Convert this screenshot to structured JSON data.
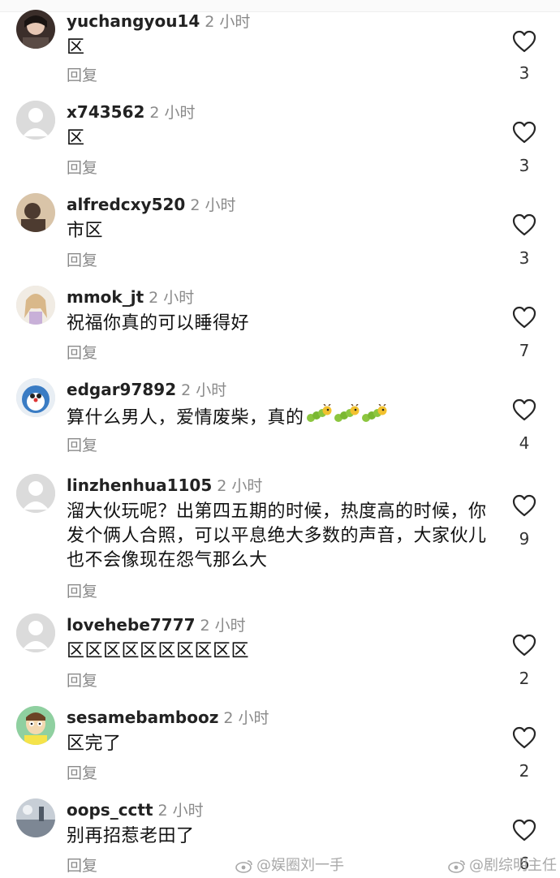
{
  "comments": [
    {
      "username": "yuchangyou14",
      "time": "2 小时",
      "text": "区",
      "reply": "回复",
      "likes": "3"
    },
    {
      "username": "x743562",
      "time": "2 小时",
      "text": "区",
      "reply": "回复",
      "likes": "3"
    },
    {
      "username": "alfredcxy520",
      "time": "2 小时",
      "text": "市区",
      "reply": "回复",
      "likes": "3"
    },
    {
      "username": "mmok_jt",
      "time": "2 小时",
      "text": "祝福你真的可以睡得好",
      "reply": "回复",
      "likes": "7"
    },
    {
      "username": "edgar97892",
      "time": "2 小时",
      "text": "算什么男人，爱情废柴，真的",
      "reply": "回复",
      "likes": "4",
      "emoji_count": 3
    },
    {
      "username": "linzhenhua1105",
      "time": "2 小时",
      "text": "溜大伙玩呢？出第四五期的时候，热度高的时候，你发个俩人合照，可以平息绝大多数的声音，大家伙儿也不会像现在怨气那么大",
      "reply": "回复",
      "likes": "9"
    },
    {
      "username": "lovehebe7777",
      "time": "2 小时",
      "text": "区区区区区区区区区区",
      "reply": "回复",
      "likes": "2"
    },
    {
      "username": "sesamebambooz",
      "time": "2 小时",
      "text": "区完了",
      "reply": "回复",
      "likes": "2"
    },
    {
      "username": "oops_cctt",
      "time": "2 小时",
      "text": "别再招惹老田了",
      "reply": "回复",
      "likes": "6"
    }
  ],
  "watermarks": {
    "left": "@娱圈刘一手",
    "right": "@剧综明主任"
  },
  "colors": {
    "muted": "#8a8a8a",
    "text": "#111111",
    "heart_outline": "#262626"
  },
  "icons": {
    "like": "heart-outline-icon",
    "emoji": "caterpillar-emoji-icon",
    "watermark": "weibo-logo-icon"
  }
}
